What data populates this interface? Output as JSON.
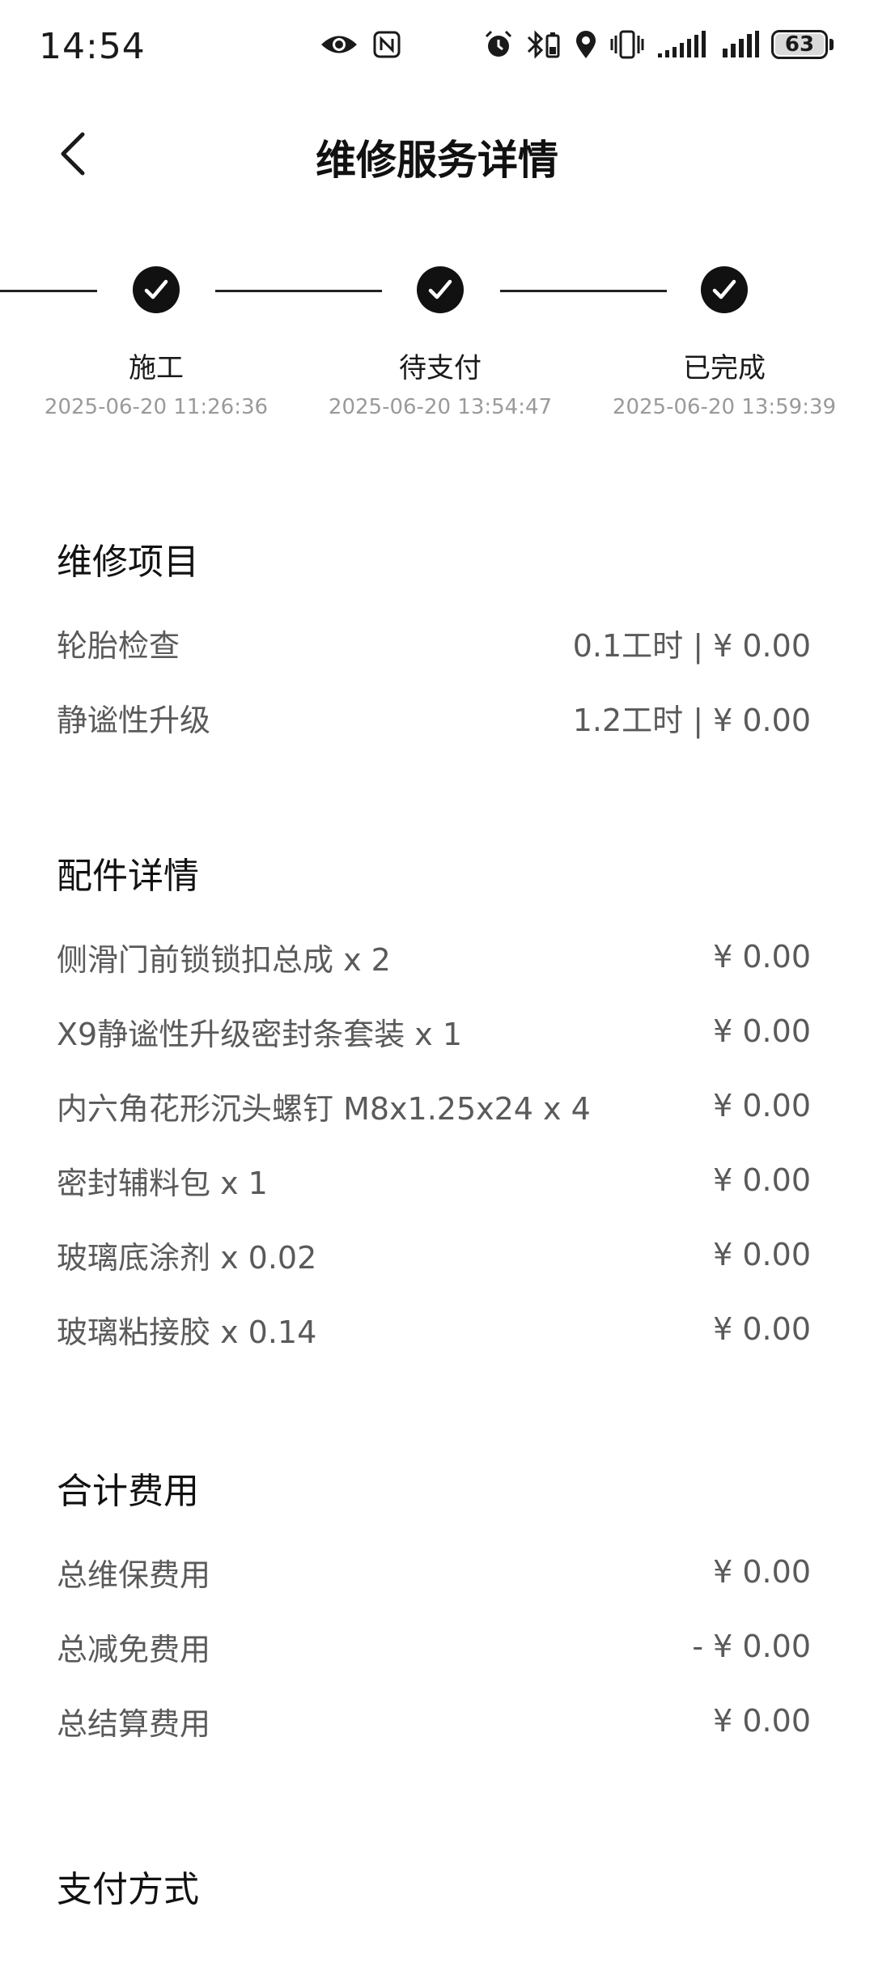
{
  "status_bar": {
    "time": "14:54",
    "battery": "63",
    "icons": [
      "eye-icon",
      "nfc-icon",
      "alarm-icon",
      "bluetooth-battery-icon",
      "location-icon",
      "vibrate-icon",
      "signal-icon",
      "signal-icon"
    ]
  },
  "header": {
    "title": "维修服务详情",
    "back_icon": "chevron-left-icon"
  },
  "progress": {
    "steps": [
      {
        "label": "施工",
        "time": "2025-06-20 11:26:36",
        "done": true
      },
      {
        "label": "待支付",
        "time": "2025-06-20 13:54:47",
        "done": true
      },
      {
        "label": "已完成",
        "time": "2025-06-20 13:59:39",
        "done": true
      }
    ]
  },
  "repair_items": {
    "title": "维修项目",
    "rows": [
      {
        "name": "轮胎检查",
        "value": "0.1工时 | ¥ 0.00"
      },
      {
        "name": "静谧性升级",
        "value": "1.2工时 | ¥ 0.00"
      }
    ]
  },
  "parts": {
    "title": "配件详情",
    "rows": [
      {
        "name": "侧滑门前锁锁扣总成 x 2",
        "value": "¥ 0.00"
      },
      {
        "name": "X9静谧性升级密封条套装 x 1",
        "value": "¥ 0.00"
      },
      {
        "name": "内六角花形沉头螺钉 M8x1.25x24 x 4",
        "value": "¥ 0.00"
      },
      {
        "name": "密封辅料包 x 1",
        "value": "¥ 0.00"
      },
      {
        "name": "玻璃底涂剂 x 0.02",
        "value": "¥ 0.00"
      },
      {
        "name": "玻璃粘接胶 x 0.14",
        "value": "¥ 0.00"
      }
    ]
  },
  "totals": {
    "title": "合计费用",
    "rows": [
      {
        "name": "总维保费用",
        "value": "¥ 0.00"
      },
      {
        "name": "总减免费用",
        "value": "- ¥ 0.00"
      },
      {
        "name": "总结算费用",
        "value": "¥ 0.00"
      }
    ]
  },
  "payment": {
    "title": "支付方式"
  }
}
